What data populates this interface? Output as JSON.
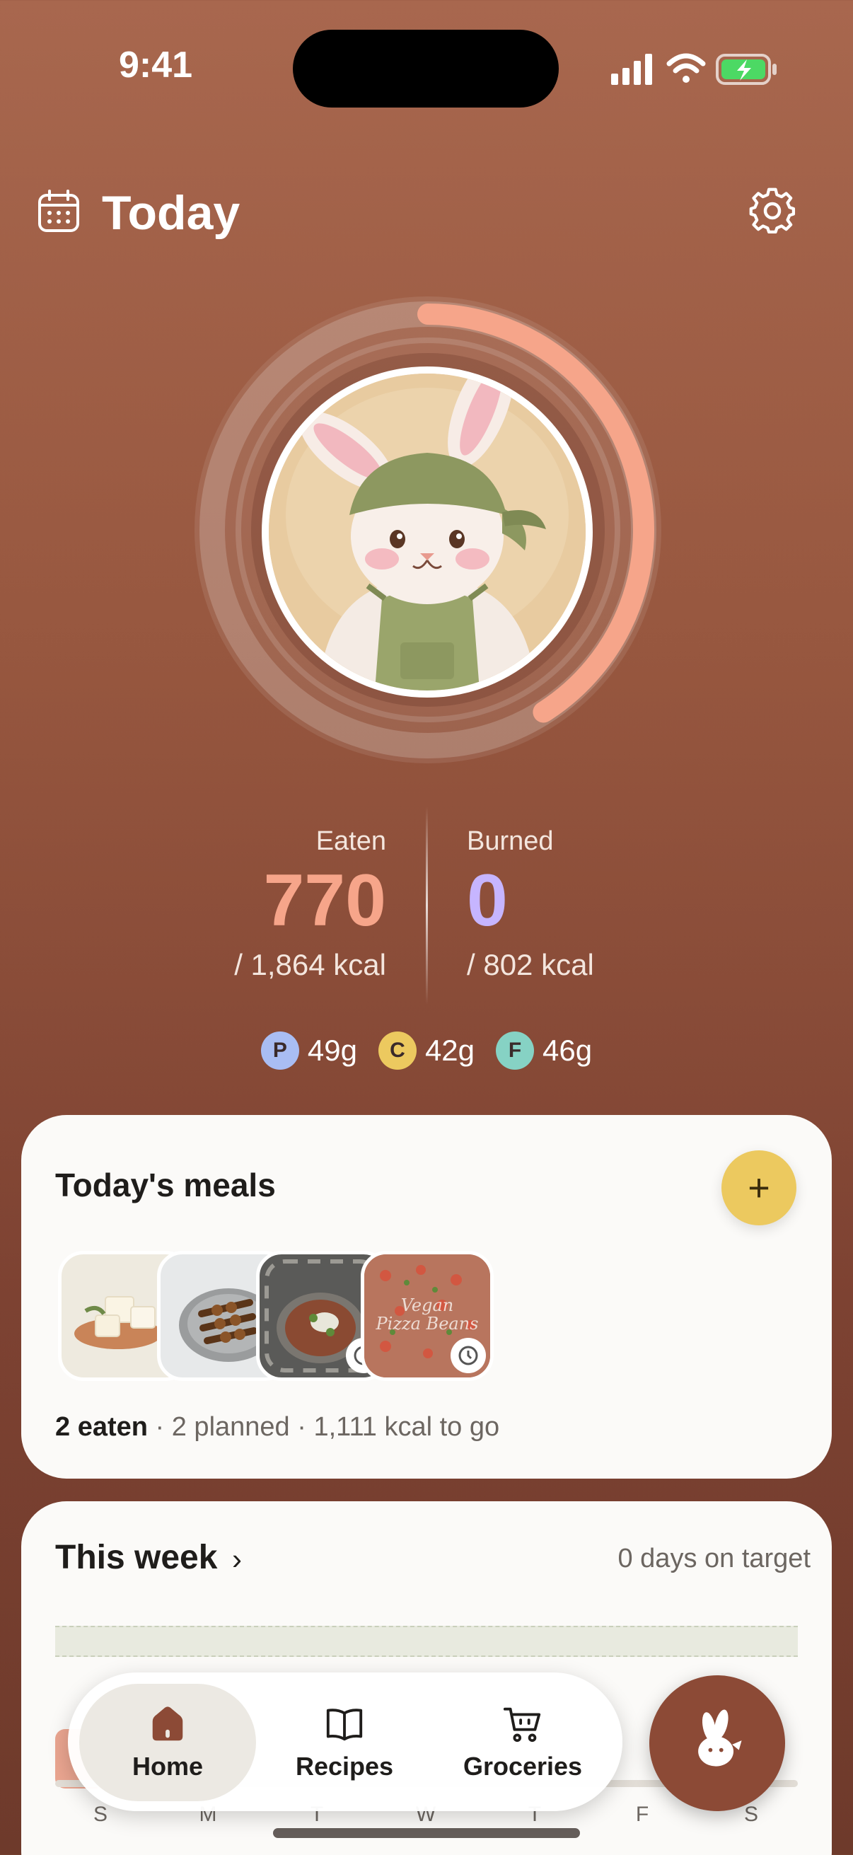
{
  "status_bar": {
    "time": "9:41"
  },
  "header": {
    "title": "Today",
    "calendar_icon": "calendar-icon",
    "settings_icon": "gear-icon"
  },
  "progress": {
    "eaten_fraction": 0.41,
    "ring_color": "#f6a58a"
  },
  "stats": {
    "eaten_label": "Eaten",
    "eaten_value": "770",
    "eaten_goal": "/ 1,864 kcal",
    "burned_label": "Burned",
    "burned_value": "0",
    "burned_goal": "/ 802 kcal"
  },
  "macros": [
    {
      "letter": "P",
      "value": "49g",
      "color": "#a9bdf3"
    },
    {
      "letter": "C",
      "value": "42g",
      "color": "#ecc95f"
    },
    {
      "letter": "F",
      "value": "46g",
      "color": "#86d2c4"
    }
  ],
  "meals": {
    "title": "Today's meals",
    "add_icon": "plus-icon",
    "thumb_overlay_text": "Vegan Pizza Beans",
    "summary_eaten": "2 eaten",
    "summary_rest": " · 2 planned · 1,111 kcal to go"
  },
  "week": {
    "title": "This week",
    "chevron": "›",
    "target_text": "0 days on target",
    "days": [
      "S",
      "M",
      "T",
      "W",
      "T",
      "F",
      "S"
    ]
  },
  "tabs": {
    "home": "Home",
    "recipes": "Recipes",
    "groceries": "Groceries"
  }
}
